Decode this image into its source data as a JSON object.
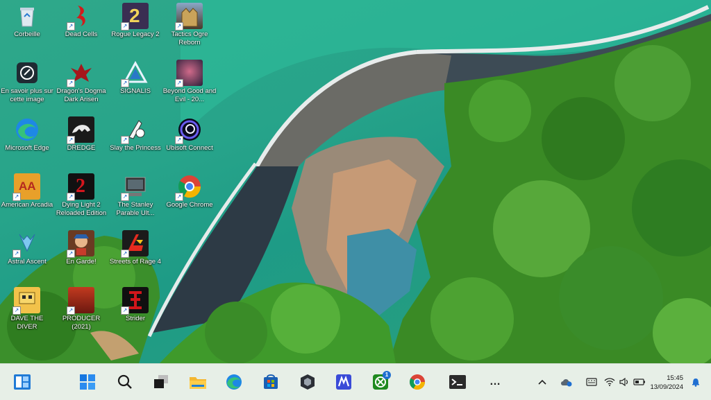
{
  "desktop": {
    "icons": [
      {
        "label": "Corbeille",
        "icon": "recycle-bin-icon"
      },
      {
        "label": "En savoir plus sur cette image",
        "icon": "learn-more-icon"
      },
      {
        "label": "Microsoft Edge",
        "icon": "edge-icon"
      },
      {
        "label": "American Arcadia",
        "icon": "american-arcadia-icon"
      },
      {
        "label": "Astral Ascent",
        "icon": "astral-ascent-icon"
      },
      {
        "label": "DAVE THE DIVER",
        "icon": "dave-the-diver-icon"
      },
      {
        "label": "Dead Cells",
        "icon": "dead-cells-icon"
      },
      {
        "label": "Dragon's Dogma Dark Arisen",
        "icon": "dragons-dogma-icon"
      },
      {
        "label": "DREDGE",
        "icon": "dredge-icon"
      },
      {
        "label": "Dying Light 2 Reloaded Edition",
        "icon": "dying-light-2-icon"
      },
      {
        "label": "En Garde!",
        "icon": "en-garde-icon"
      },
      {
        "label": "PRODUCER (2021)",
        "icon": "producer-icon"
      },
      {
        "label": "Rogue Legacy 2",
        "icon": "rogue-legacy-2-icon"
      },
      {
        "label": "SIGNALIS",
        "icon": "signalis-icon"
      },
      {
        "label": "Slay the Princess",
        "icon": "slay-the-princess-icon"
      },
      {
        "label": "The Stanley Parable Ult...",
        "icon": "stanley-parable-icon"
      },
      {
        "label": "Streets of Rage 4",
        "icon": "streets-of-rage-4-icon"
      },
      {
        "label": "Strider",
        "icon": "strider-icon"
      },
      {
        "label": "Tactics Ogre Reborn",
        "icon": "tactics-ogre-icon"
      },
      {
        "label": "Beyond Good and Evil - 20...",
        "icon": "beyond-good-and-evil-icon"
      },
      {
        "label": "Ubisoft Connect",
        "icon": "ubisoft-connect-icon"
      },
      {
        "label": "Google Chrome",
        "icon": "chrome-icon"
      }
    ]
  },
  "taskbar": {
    "xbox_badge": "1",
    "more_label": "…",
    "clock": {
      "time": "15:45",
      "date": "13/09/2024"
    }
  },
  "colors": {
    "taskbar_bg": "#e7efe7",
    "water": "#27a48a",
    "forest": "#3a8a25"
  }
}
